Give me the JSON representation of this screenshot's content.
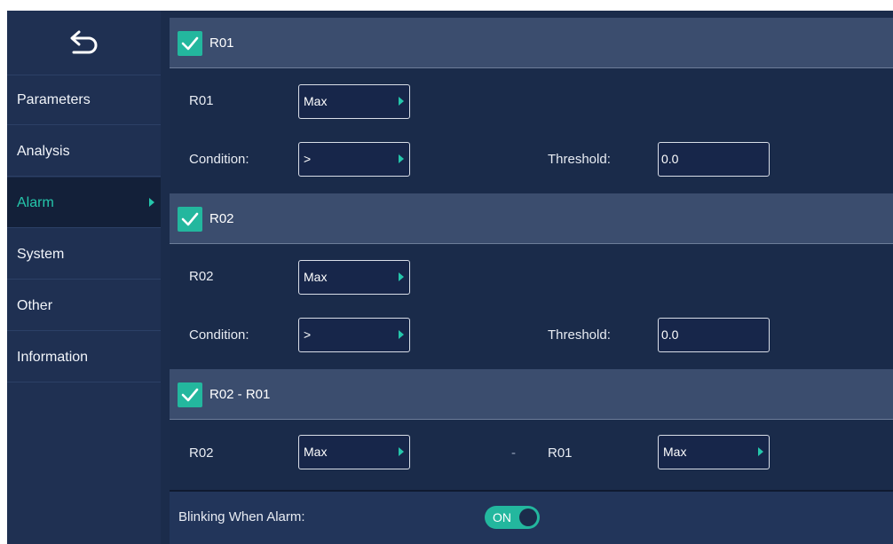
{
  "sidebar": {
    "back_icon": "back-arrow-icon",
    "items": [
      {
        "label": "Parameters"
      },
      {
        "label": "Analysis"
      },
      {
        "label": "Alarm",
        "active": true
      },
      {
        "label": "System"
      },
      {
        "label": "Other"
      },
      {
        "label": "Information"
      }
    ]
  },
  "sections": [
    {
      "title": "R01",
      "checked": true,
      "row1": {
        "label": "R01",
        "select": "Max"
      },
      "row2": {
        "condition_label": "Condition:",
        "condition": ">",
        "threshold_label": "Threshold:",
        "threshold": "0.0"
      }
    },
    {
      "title": "R02",
      "checked": true,
      "row1": {
        "label": "R02",
        "select": "Max"
      },
      "row2": {
        "condition_label": "Condition:",
        "condition": ">",
        "threshold_label": "Threshold:",
        "threshold": "0.0"
      }
    },
    {
      "title": "R02 - R01",
      "checked": true,
      "row1": {
        "left_label": "R02",
        "left_select": "Max",
        "minus": "-",
        "right_label": "R01",
        "right_select": "Max"
      }
    }
  ],
  "footer": {
    "blink_label": "Blinking When Alarm:",
    "toggle_label": "ON",
    "toggle_on": true
  },
  "colors": {
    "accent": "#23b79e",
    "background": "#1b2c4b",
    "header": "#3b4d6e",
    "sidebar": "#1f3052",
    "active_item": "#132039"
  }
}
